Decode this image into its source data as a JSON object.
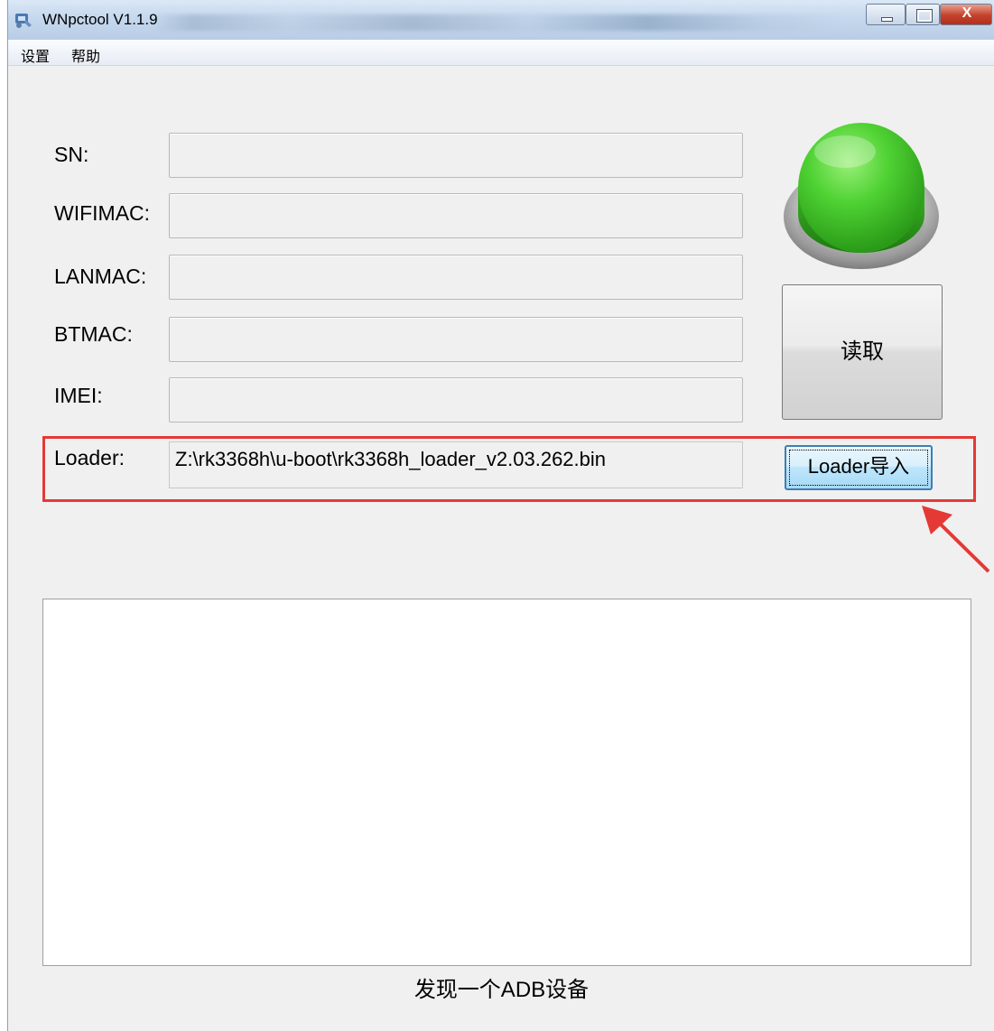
{
  "window": {
    "title": "WNpctool V1.1.9",
    "close_glyph": "X"
  },
  "menu": {
    "items": [
      {
        "label": "设置"
      },
      {
        "label": "帮助"
      }
    ]
  },
  "form": {
    "fields": [
      {
        "label": "SN:",
        "value": ""
      },
      {
        "label": "WIFIMAC:",
        "value": ""
      },
      {
        "label": "LANMAC:",
        "value": ""
      },
      {
        "label": "BTMAC:",
        "value": ""
      },
      {
        "label": "IMEI:",
        "value": ""
      }
    ],
    "loader_label": "Loader:",
    "loader_path": "Z:\\rk3368h\\u-boot\\rk3368h_loader_v2.03.262.bin"
  },
  "buttons": {
    "read_label": "读取",
    "loader_import_label": "Loader导入",
    "status_indicator_icon": "green-round-button-icon"
  },
  "log": {
    "content": ""
  },
  "status_text": "发现一个ADB设备",
  "colors": {
    "annotation_red": "#e53935",
    "indicator_green": "#3bc62a",
    "window_bg": "#f0f0f0"
  }
}
